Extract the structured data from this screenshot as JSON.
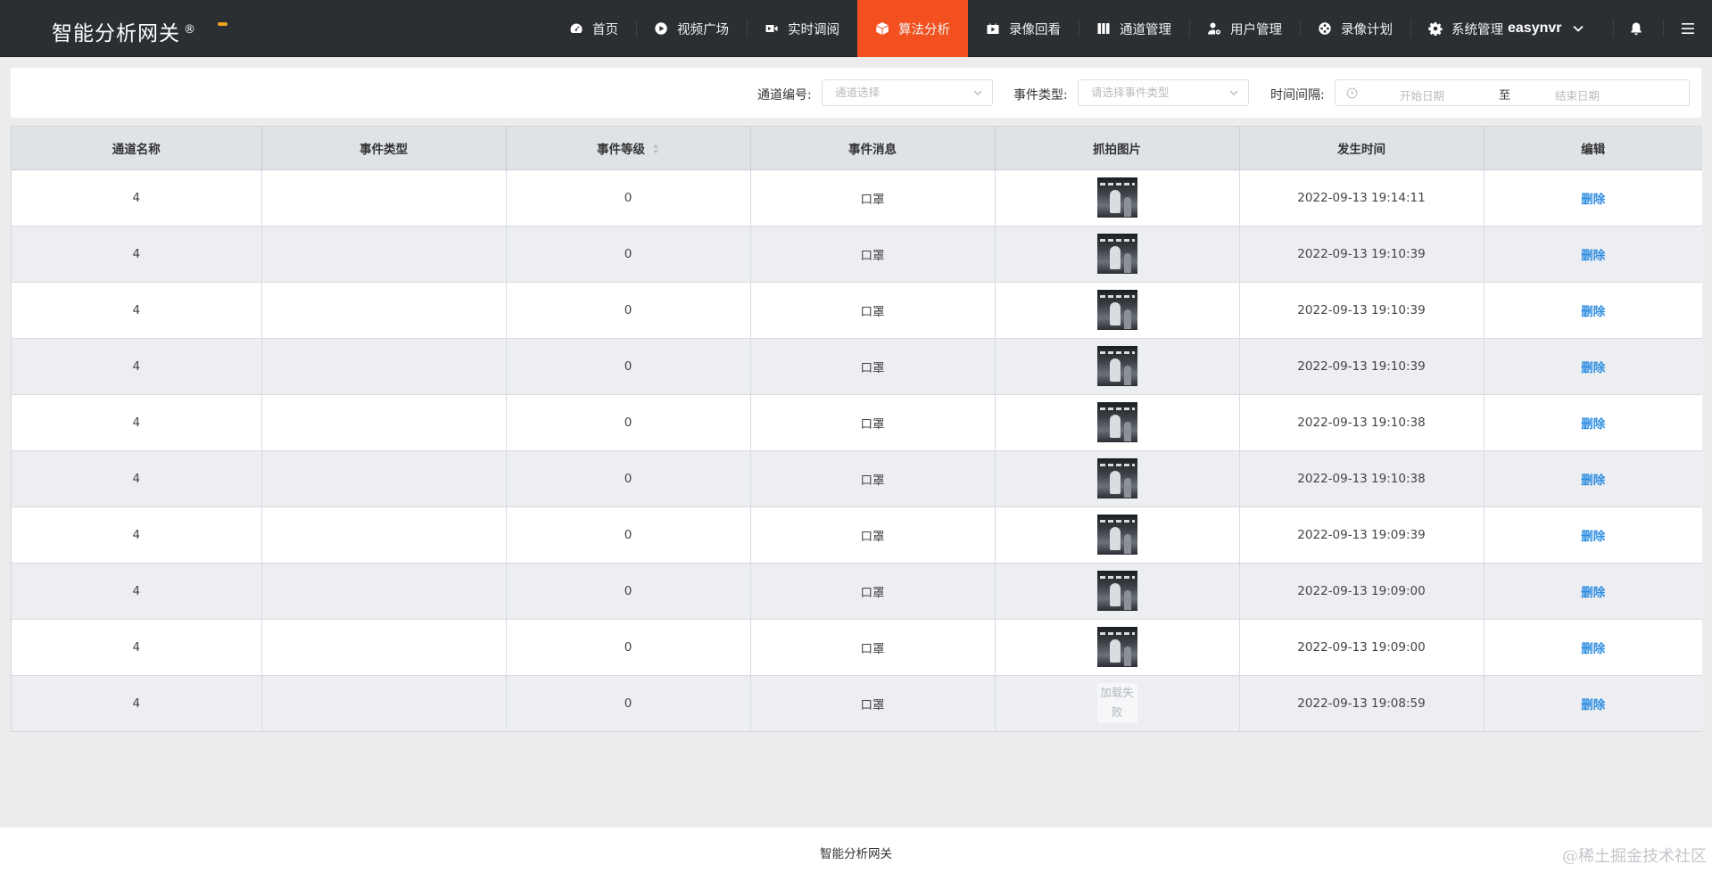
{
  "header": {
    "brand": "智能分析网关",
    "brand_mark": "®",
    "nav": [
      {
        "label": "首页",
        "icon": "dashboard-icon",
        "active": false
      },
      {
        "label": "视频广场",
        "icon": "play-circle-icon",
        "active": false
      },
      {
        "label": "实时调阅",
        "icon": "video-camera-icon",
        "active": false
      },
      {
        "label": "算法分析",
        "icon": "cube-icon",
        "active": true
      },
      {
        "label": "录像回看",
        "icon": "playback-icon",
        "active": false
      },
      {
        "label": "通道管理",
        "icon": "columns-icon",
        "active": false
      },
      {
        "label": "用户管理",
        "icon": "user-gear-icon",
        "active": false
      },
      {
        "label": "录像计划",
        "icon": "film-reel-icon",
        "active": false
      },
      {
        "label": "系统管理",
        "icon": "gear-icon",
        "active": false
      }
    ],
    "username": "easynvr"
  },
  "filter": {
    "channel_label": "通道编号:",
    "channel_placeholder": "通道选择",
    "event_label": "事件类型:",
    "event_placeholder": "请选择事件类型",
    "time_label": "时间间隔:",
    "start_placeholder": "开始日期",
    "range_separator": "至",
    "end_placeholder": "结束日期"
  },
  "table": {
    "columns": [
      "通道名称",
      "事件类型",
      "事件等级",
      "事件消息",
      "抓拍图片",
      "发生时间",
      "编辑"
    ],
    "rows": [
      {
        "channel": "4",
        "type": "",
        "level": "0",
        "message": "口罩",
        "image": "ok",
        "time": "2022-09-13 19:14:11",
        "action": "删除"
      },
      {
        "channel": "4",
        "type": "",
        "level": "0",
        "message": "口罩",
        "image": "ok",
        "time": "2022-09-13 19:10:39",
        "action": "删除"
      },
      {
        "channel": "4",
        "type": "",
        "level": "0",
        "message": "口罩",
        "image": "ok",
        "time": "2022-09-13 19:10:39",
        "action": "删除"
      },
      {
        "channel": "4",
        "type": "",
        "level": "0",
        "message": "口罩",
        "image": "ok",
        "time": "2022-09-13 19:10:39",
        "action": "删除"
      },
      {
        "channel": "4",
        "type": "",
        "level": "0",
        "message": "口罩",
        "image": "ok",
        "time": "2022-09-13 19:10:38",
        "action": "删除"
      },
      {
        "channel": "4",
        "type": "",
        "level": "0",
        "message": "口罩",
        "image": "ok",
        "time": "2022-09-13 19:10:38",
        "action": "删除"
      },
      {
        "channel": "4",
        "type": "",
        "level": "0",
        "message": "口罩",
        "image": "ok",
        "time": "2022-09-13 19:09:39",
        "action": "删除"
      },
      {
        "channel": "4",
        "type": "",
        "level": "0",
        "message": "口罩",
        "image": "ok",
        "time": "2022-09-13 19:09:00",
        "action": "删除"
      },
      {
        "channel": "4",
        "type": "",
        "level": "0",
        "message": "口罩",
        "image": "ok",
        "time": "2022-09-13 19:09:00",
        "action": "删除"
      },
      {
        "channel": "4",
        "type": "",
        "level": "0",
        "message": "口罩",
        "image": "failed",
        "time": "2022-09-13 19:08:59",
        "action": "删除"
      }
    ],
    "image_failed_text": "加载失败"
  },
  "footer": {
    "text": "智能分析网关",
    "watermark": "@稀土掘金技术社区"
  },
  "colors": {
    "header_bg": "#2b2f33",
    "active_tab": "#f2501e",
    "link": "#2a8be0",
    "brand_dot": "#f0a31c"
  }
}
